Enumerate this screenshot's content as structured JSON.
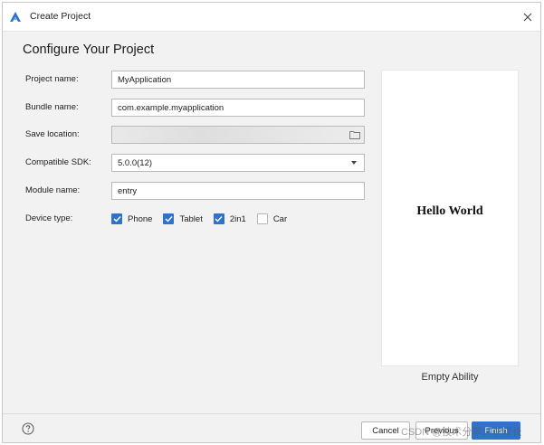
{
  "window": {
    "title": "Create Project"
  },
  "page": {
    "heading": "Configure Your Project"
  },
  "form": {
    "project_name": {
      "label": "Project name:",
      "value": "MyApplication"
    },
    "bundle_name": {
      "label": "Bundle name:",
      "value": "com.example.myapplication"
    },
    "save_location": {
      "label": "Save location:",
      "value": ""
    },
    "compatible_sdk": {
      "label": "Compatible SDK:",
      "value": "5.0.0(12)"
    },
    "module_name": {
      "label": "Module name:",
      "value": "entry"
    },
    "device_type": {
      "label": "Device type:",
      "options": [
        {
          "label": "Phone",
          "checked": true
        },
        {
          "label": "Tablet",
          "checked": true
        },
        {
          "label": "2in1",
          "checked": true
        },
        {
          "label": "Car",
          "checked": false
        }
      ]
    }
  },
  "preview": {
    "text": "Hello World",
    "template_name": "Empty Ability"
  },
  "footer": {
    "cancel_label": "Cancel",
    "previous_label": "Previous",
    "finish_label": "Finish",
    "watermark": "CSDN @技术分享共享成长"
  },
  "colors": {
    "accent": "#2f72c9",
    "window_bg": "#f2f2f2",
    "logo": "#2f72c9"
  }
}
